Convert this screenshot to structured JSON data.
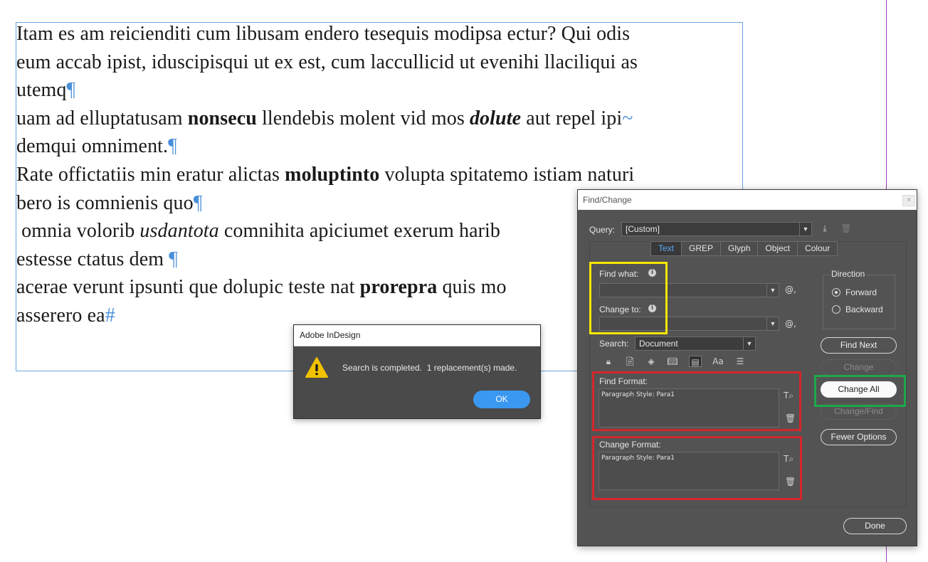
{
  "document": {
    "lines": [
      "Itam es am reicienditi cum libusam endero tesequis modipsa ectur? Qui odis",
      "eum accab ipist, iduscipisqui ut ex est, cum laccullicid ut evenihi llaciliqui as",
      "utemq¶",
      "uam ad elluptatusam nonsecu llendebis molent vid mos dolute aut repel ipi~",
      "demqui omniment.¶",
      "Rate offictatiis min eratur alictas moluptinto volupta spitatemo istiam naturi",
      "bero is comnienis quo¶",
      " omnia volorib usdantota comnihita apiciumet exerum harib",
      "estesse ctatus dem ¶",
      "acerae verunt ipsunti que dolupic teste nat prorepra quis mo",
      "asserero ea#"
    ]
  },
  "alert": {
    "title": "Adobe InDesign",
    "message": "Search is completed.  1 replacement(s) made.",
    "ok_label": "OK",
    "icon": "warning-icon"
  },
  "find_change": {
    "title": "Find/Change",
    "close_label": "×",
    "query_label": "Query:",
    "query_value": "[Custom]",
    "tabs": [
      "Text",
      "GREP",
      "Glyph",
      "Object",
      "Colour"
    ],
    "active_tab": "Text",
    "find_what_label": "Find what:",
    "find_what_value": "",
    "change_to_label": "Change to:",
    "change_to_value": "",
    "search_label": "Search:",
    "search_value": "Document",
    "find_format_label": "Find Format:",
    "find_format_value": "Paragraph Style: Para1",
    "change_format_label": "Change Format:",
    "change_format_value": "Paragraph Style: Para1",
    "direction_label": "Direction",
    "direction_forward": "Forward",
    "direction_backward": "Backward",
    "direction_selected": "Forward",
    "buttons": {
      "find_next": "Find Next",
      "change": "Change",
      "change_all": "Change All",
      "change_find": "Change/Find",
      "fewer_options": "Fewer Options",
      "done": "Done"
    },
    "colors": {
      "highlight_find_change": "#f5e600",
      "highlight_formats": "#d3262b",
      "highlight_change_all": "#1ea84a",
      "active_tab_text": "#5aa9f5"
    }
  }
}
